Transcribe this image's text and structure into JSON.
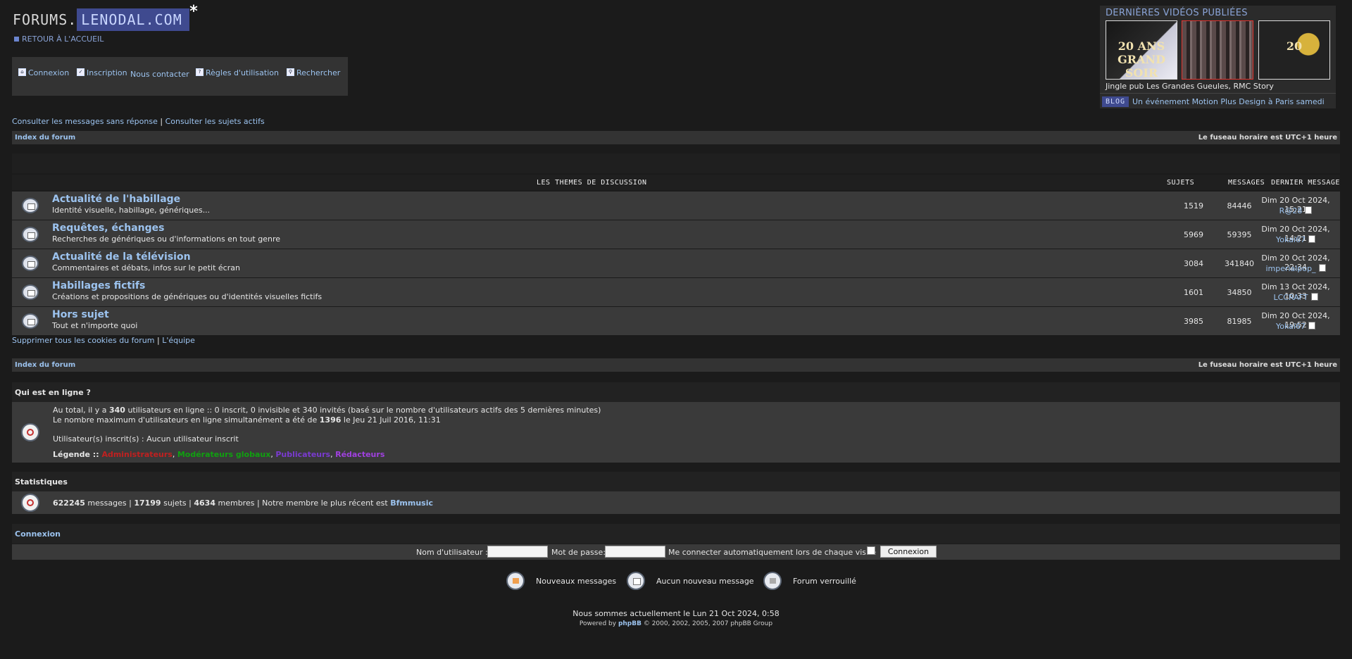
{
  "header": {
    "logo_part1": "FORUMS.",
    "logo_part2": "LENODAL.COM",
    "logo_star": "*",
    "home_link": "RETOUR À L'ACCUEIL"
  },
  "menu": {
    "items": [
      {
        "label": "Connexion",
        "icon": "login-icon"
      },
      {
        "label": "Inscription",
        "icon": "register-icon"
      },
      {
        "label": "Nous contacter",
        "icon": ""
      },
      {
        "label": "Règles d'utilisation",
        "icon": "faq-icon"
      },
      {
        "label": "Rechercher",
        "icon": "search-icon"
      }
    ]
  },
  "videos": {
    "title": "DERNIÈRES VIDÉOS PUBLIÉES",
    "thumbs": [
      {
        "label": "20 ANS GRAND SOIR",
        "selected": false
      },
      {
        "label": "",
        "selected": true
      },
      {
        "label": "20",
        "selected": false
      }
    ],
    "caption": "Jingle pub Les Grandes Gueules, RMC Story",
    "blog_badge": "BLOG",
    "blog_text": "Un événement Motion Plus Design à Paris samedi"
  },
  "quicklinks": {
    "unanswered": "Consulter les messages sans réponse",
    "sep": " | ",
    "active": "Consulter les sujets actifs"
  },
  "navbar": {
    "index": "Index du forum",
    "timezone": "Le fuseau horaire est UTC+1 heure"
  },
  "forum_table": {
    "headers": {
      "themes": "LES THEMES DE DISCUSSION",
      "topics": "SUJETS",
      "messages": "MESSAGES",
      "last": "DERNIER MESSAGE"
    },
    "rows": [
      {
        "name": "Actualité de l'habillage",
        "desc": "Identité visuelle, habillage, génériques...",
        "topics": "1519",
        "posts": "84446",
        "last_date": "Dim 20 Oct 2024, 15:21",
        "last_user": "R@28"
      },
      {
        "name": "Requêtes, échanges",
        "desc": "Recherches de génériques ou d'informations en tout genre",
        "topics": "5969",
        "posts": "59395",
        "last_date": "Dim 20 Oct 2024, 14:21",
        "last_user": "Yokai67"
      },
      {
        "name": "Actualité de la télévision",
        "desc": "Commentaires et débats, infos sur le petit écran",
        "topics": "3084",
        "posts": "341840",
        "last_date": "Dim 20 Oct 2024, 22:34",
        "last_user": "imperialpop_"
      },
      {
        "name": "Habillages fictifs",
        "desc": "Créations et propositions de génériques ou d'identités visuelles fictifs",
        "topics": "1601",
        "posts": "34850",
        "last_date": "Dim 13 Oct 2024, 10:33",
        "last_user": "LCCRAFT"
      },
      {
        "name": "Hors sujet",
        "desc": "Tout et n'importe quoi",
        "topics": "3985",
        "posts": "81985",
        "last_date": "Dim 20 Oct 2024, 19:52",
        "last_user": "Yokai67"
      }
    ]
  },
  "bottom_links": {
    "cookies": "Supprimer tous les cookies du forum",
    "sep": " | ",
    "team": "L'équipe"
  },
  "online": {
    "title": "Qui est en ligne ?",
    "line1_pre": "Au total, il y a ",
    "line1_count": "340",
    "line1_post": " utilisateurs en ligne :: 0 inscrit, 0 invisible et 340 invités (basé sur le nombre d'utilisateurs actifs des 5 dernières minutes)",
    "line2_pre": "Le nombre maximum d'utilisateurs en ligne simultanément a été de ",
    "line2_count": "1396",
    "line2_post": " le Jeu 21 Juil 2016, 11:31",
    "line3": "Utilisateur(s) inscrit(s) : Aucun utilisateur inscrit",
    "legend_label": "Légende :: ",
    "legend_admin": "Administrateurs",
    "legend_gmod": "Modérateurs globaux",
    "legend_pub": "Publicateurs",
    "legend_red": "Rédacteurs",
    "comma": ", "
  },
  "stats": {
    "title": "Statistiques",
    "messages": "622245",
    "messages_label": " messages | ",
    "topics": "17199",
    "topics_label": " sujets | ",
    "members": "4634",
    "members_label": " membres | Notre membre le plus récent est ",
    "newest": "Bfmmusic"
  },
  "login": {
    "title": "Connexion",
    "username_label": "Nom d'utilisateur :",
    "password_label": "Mot de passe:",
    "autologin_label": "Me connecter automatiquement lors de chaque visite",
    "submit": "Connexion"
  },
  "legend": {
    "new": "Nouveaux messages",
    "none": "Aucun nouveau message",
    "locked": "Forum verrouillé"
  },
  "footer": {
    "now": "Nous sommes actuellement le Lun 21 Oct 2024, 0:58",
    "powered_pre": "Powered by ",
    "powered_link": "phpBB",
    "powered_post": " © 2000, 2002, 2005, 2007 phpBB Group"
  }
}
